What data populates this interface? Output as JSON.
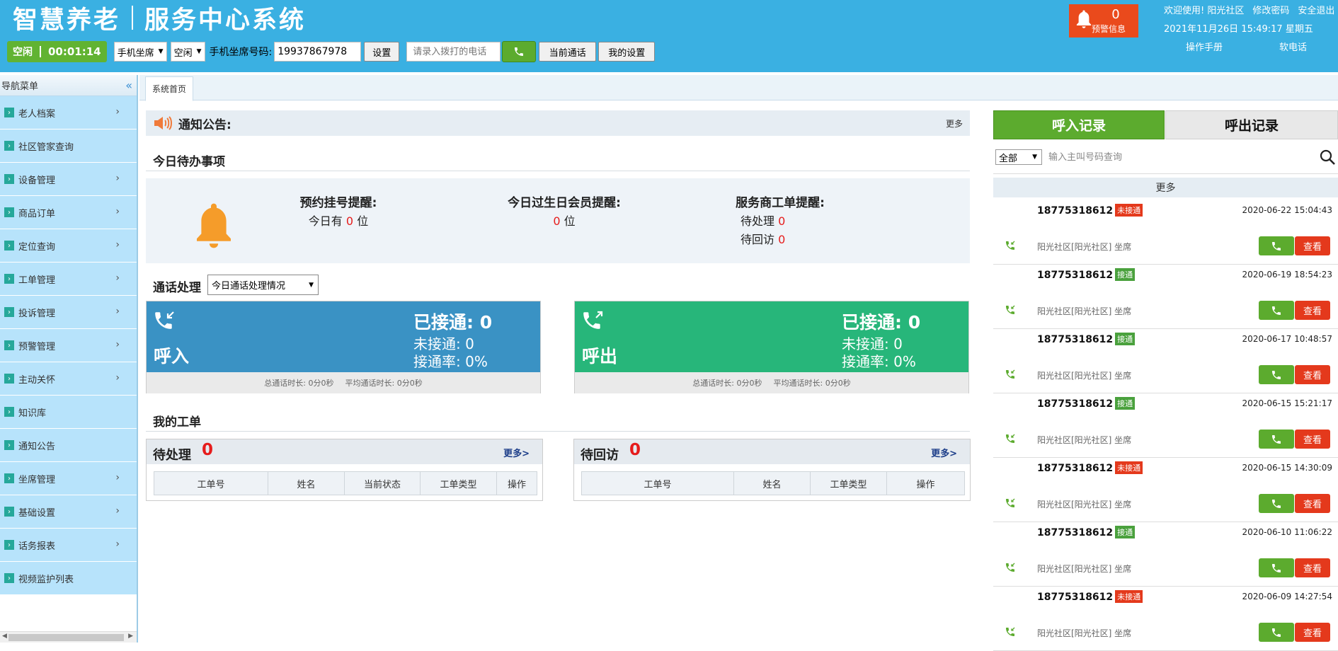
{
  "app": {
    "title_left": "智慧养老",
    "title_right": "服务中心系统"
  },
  "toolbar": {
    "status": "空闲",
    "timer": "00:01:14",
    "seat_type": "手机坐席",
    "seat_status": "空闲",
    "phone_label": "手机坐席号码:",
    "phone_value": "19937867978",
    "set_label": "设置",
    "dial_placeholder": "请录入拨打的电话",
    "current_call": "当前通话",
    "my_settings": "我的设置"
  },
  "alert": {
    "count": "0",
    "label": "预警信息"
  },
  "user": {
    "welcome": "欢迎使用! 阳光社区",
    "change_pwd": "修改密码",
    "logout": "安全退出",
    "datetime": "2021年11月26日 15:49:17 星期五",
    "manual": "操作手册",
    "softphone": "软电话"
  },
  "sidebar": {
    "title": "导航菜单",
    "items": [
      {
        "label": "老人档案",
        "chev": true
      },
      {
        "label": "社区管家查询",
        "chev": false
      },
      {
        "label": "设备管理",
        "chev": true
      },
      {
        "label": "商品订单",
        "chev": true
      },
      {
        "label": "定位查询",
        "chev": true
      },
      {
        "label": "工单管理",
        "chev": true
      },
      {
        "label": "投诉管理",
        "chev": true
      },
      {
        "label": "预警管理",
        "chev": true
      },
      {
        "label": "主动关怀",
        "chev": true
      },
      {
        "label": "知识库",
        "chev": false
      },
      {
        "label": "通知公告",
        "chev": false
      },
      {
        "label": "坐席管理",
        "chev": true
      },
      {
        "label": "基础设置",
        "chev": true
      },
      {
        "label": "话务报表",
        "chev": true
      },
      {
        "label": "视频监护列表",
        "chev": false
      }
    ]
  },
  "tabs": {
    "home": "系统首页"
  },
  "notice": {
    "title": "通知公告:",
    "more": "更多"
  },
  "todo": {
    "title": "今日待办事项",
    "appointment_title": "预约挂号提醒:",
    "appointment_prefix": "今日有",
    "appointment_count": "0",
    "appointment_suffix": "位",
    "birthday_title": "今日过生日会员提醒:",
    "birthday_count": "0",
    "birthday_suffix": "位",
    "provider_title": "服务商工单提醒:",
    "pending_label": "待处理",
    "pending_count": "0",
    "revisit_label": "待回访",
    "revisit_count": "0"
  },
  "calls": {
    "title": "通话处理",
    "select_value": "今日通话处理情况",
    "incoming": {
      "title": "呼入",
      "connected": "已接通: 0",
      "missed": "未接通: 0",
      "rate": "接通率: 0%",
      "total": "总通话时长: 0分0秒",
      "avg": "平均通话时长: 0分0秒"
    },
    "outgoing": {
      "title": "呼出",
      "connected": "已接通: 0",
      "missed": "未接通: 0",
      "rate": "接通率: 0%",
      "total": "总通话时长: 0分0秒",
      "avg": "平均通话时长: 0分0秒"
    }
  },
  "workorders": {
    "title": "我的工单",
    "pending": {
      "title": "待处理",
      "count": "0",
      "more": "更多>",
      "cols": [
        "工单号",
        "姓名",
        "当前状态",
        "工单类型",
        "操作"
      ]
    },
    "revisit": {
      "title": "待回访",
      "count": "0",
      "more": "更多>",
      "cols": [
        "工单号",
        "姓名",
        "工单类型",
        "操作"
      ]
    }
  },
  "records": {
    "tab_in": "呼入记录",
    "tab_out": "呼出记录",
    "filter": "全部",
    "search_placeholder": "输入主叫号码查询",
    "more": "更多",
    "view_label": "查看",
    "items": [
      {
        "number": "18775318612",
        "status": "未接通",
        "connected": false,
        "time": "2020-06-22 15:04:43",
        "location": "阳光社区[阳光社区]  坐席"
      },
      {
        "number": "18775318612",
        "status": "接通",
        "connected": true,
        "time": "2020-06-19 18:54:23",
        "location": "阳光社区[阳光社区]  坐席"
      },
      {
        "number": "18775318612",
        "status": "接通",
        "connected": true,
        "time": "2020-06-17 10:48:57",
        "location": "阳光社区[阳光社区]  坐席"
      },
      {
        "number": "18775318612",
        "status": "接通",
        "connected": true,
        "time": "2020-06-15 15:21:17",
        "location": "阳光社区[阳光社区]  坐席"
      },
      {
        "number": "18775318612",
        "status": "未接通",
        "connected": false,
        "time": "2020-06-15 14:30:09",
        "location": "阳光社区[阳光社区]  坐席"
      },
      {
        "number": "18775318612",
        "status": "接通",
        "connected": true,
        "time": "2020-06-10 11:06:22",
        "location": "阳光社区[阳光社区]  坐席"
      },
      {
        "number": "18775318612",
        "status": "未接通",
        "connected": false,
        "time": "2020-06-09 14:27:54",
        "location": "阳光社区[阳光社区]  坐席"
      }
    ]
  },
  "colors": {
    "header": "#3ab0e2",
    "incoming": "#3a92c4",
    "outgoing": "#27b67a",
    "accent_green": "#5cab2e",
    "alert_red": "#ea4a1c"
  }
}
